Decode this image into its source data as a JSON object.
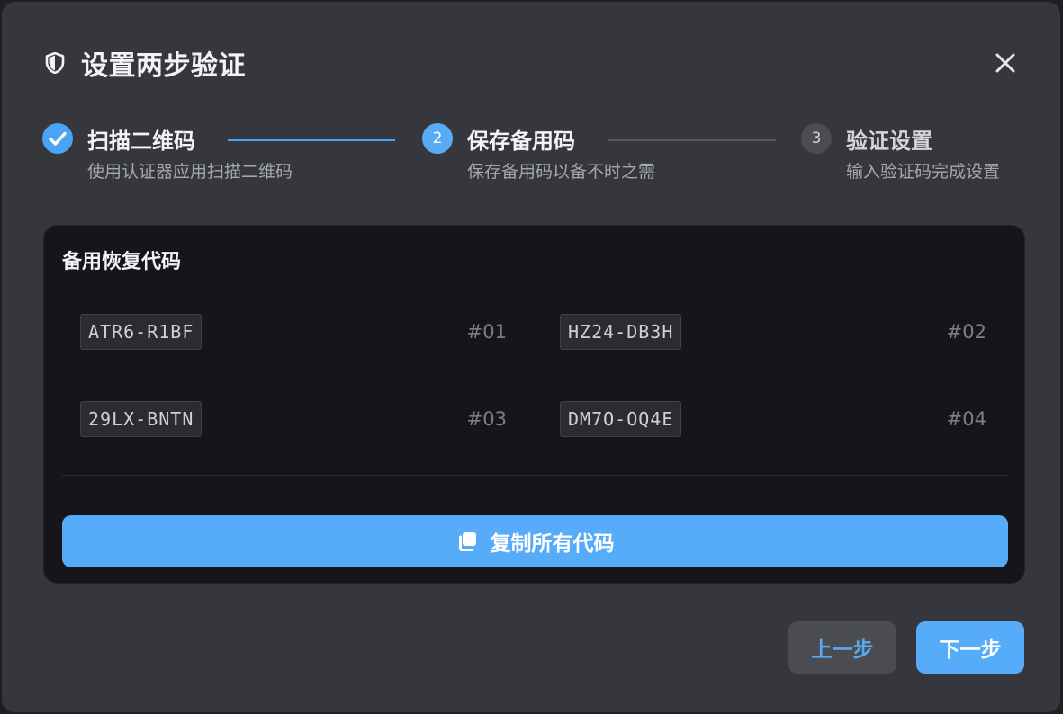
{
  "dialog": {
    "title": "设置两步验证",
    "icons": {
      "title": "shield-icon",
      "close": "close-icon",
      "copy": "copy-icon",
      "completed_step": "check-icon"
    }
  },
  "steps": [
    {
      "number": "1",
      "title": "扫描二维码",
      "description": "使用认证器应用扫描二维码",
      "status": "completed"
    },
    {
      "number": "2",
      "title": "保存备用码",
      "description": "保存备用码以备不时之需",
      "status": "active"
    },
    {
      "number": "3",
      "title": "验证设置",
      "description": "输入验证码完成设置",
      "status": "pending"
    }
  ],
  "backup_codes": {
    "title": "备用恢复代码",
    "codes": [
      {
        "code": "ATR6-R1BF",
        "number": "#01"
      },
      {
        "code": "HZ24-DB3H",
        "number": "#02"
      },
      {
        "code": "29LX-BNTN",
        "number": "#03"
      },
      {
        "code": "DM7O-OQ4E",
        "number": "#04"
      }
    ],
    "copy_all_label": "复制所有代码"
  },
  "footer": {
    "prev_label": "上一步",
    "next_label": "下一步"
  },
  "colors": {
    "accent": "#56acf8",
    "dialog_background": "#35373c",
    "panel_background": "#16161a",
    "pending_step": "#4b4d52"
  }
}
